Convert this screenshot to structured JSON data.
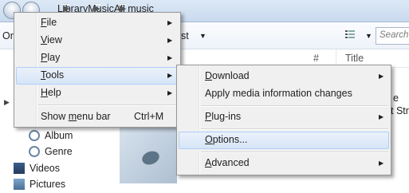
{
  "breadcrumb": [
    "Library",
    "Music",
    "All music"
  ],
  "toolbar": {
    "organize_partial": "Or",
    "playlist_partial": "st",
    "search_placeholder": "Search"
  },
  "columns": {
    "hash": "#",
    "title": "Title"
  },
  "tree": [
    {
      "label": "Album",
      "icon": "album-icon"
    },
    {
      "label": "Genre",
      "icon": "genre-icon"
    },
    {
      "label": "Videos",
      "icon": "videos-icon"
    },
    {
      "label": "Pictures",
      "icon": "pictures-icon"
    }
  ],
  "right_fragments": [
    "e",
    "t Stre"
  ],
  "main_menu": {
    "items": [
      {
        "pre": "",
        "acc": "F",
        "post": "ile",
        "submenu": true
      },
      {
        "pre": "",
        "acc": "V",
        "post": "iew",
        "submenu": true
      },
      {
        "pre": "",
        "acc": "P",
        "post": "lay",
        "submenu": true
      },
      {
        "pre": "",
        "acc": "T",
        "post": "ools",
        "submenu": true,
        "highlighted": true
      },
      {
        "pre": "",
        "acc": "H",
        "post": "elp",
        "submenu": true
      }
    ],
    "show_menu_bar": {
      "pre": "Show ",
      "acc": "m",
      "post": "enu bar",
      "shortcut": "Ctrl+M"
    }
  },
  "tools_menu": {
    "items": [
      {
        "pre": "",
        "acc": "D",
        "post": "ownload",
        "submenu": true
      },
      {
        "pre": "Apply media information changes",
        "acc": "",
        "post": "",
        "submenu": false
      },
      {
        "pre": "",
        "acc": "P",
        "post": "lug-ins",
        "submenu": true
      },
      {
        "pre": "",
        "acc": "O",
        "post": "ptions...",
        "submenu": false,
        "highlighted": true
      },
      {
        "pre": "",
        "acc": "A",
        "post": "dvanced",
        "submenu": true
      }
    ]
  }
}
